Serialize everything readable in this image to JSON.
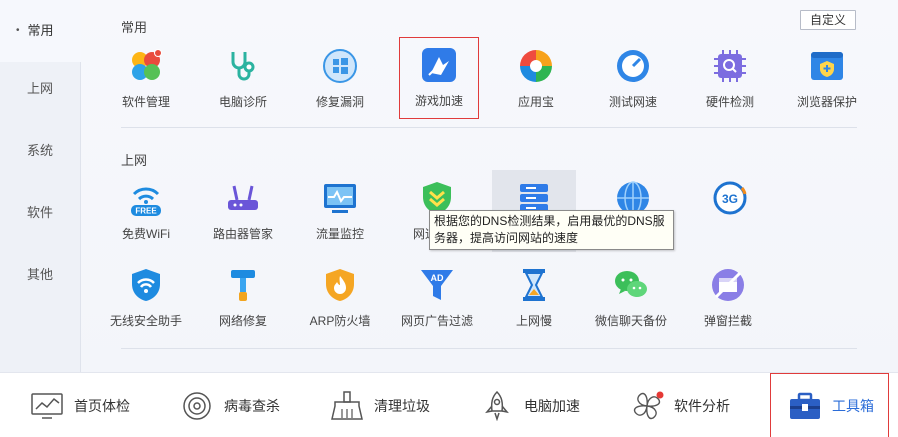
{
  "sidebar": {
    "items": [
      {
        "label": "常用",
        "active": true
      },
      {
        "label": "上网"
      },
      {
        "label": "系统"
      },
      {
        "label": "软件"
      },
      {
        "label": "其他"
      }
    ]
  },
  "header": {
    "custom_label": "自定义"
  },
  "sections": {
    "common": {
      "title": "常用",
      "tools": [
        {
          "label": "软件管理",
          "icon": "software-manager-icon"
        },
        {
          "label": "电脑诊所",
          "icon": "stethoscope-icon"
        },
        {
          "label": "修复漏洞",
          "icon": "windows-repair-icon"
        },
        {
          "label": "游戏加速",
          "icon": "game-boost-icon"
        },
        {
          "label": "应用宝",
          "icon": "app-store-icon"
        },
        {
          "label": "测试网速",
          "icon": "speed-test-icon"
        },
        {
          "label": "硬件检测",
          "icon": "chip-inspect-icon"
        },
        {
          "label": "浏览器保护",
          "icon": "browser-protect-icon"
        }
      ]
    },
    "internet": {
      "title": "上网",
      "tools_row1": [
        {
          "label": "免费WiFi",
          "icon": "free-wifi-icon",
          "badge": "FREE"
        },
        {
          "label": "路由器管家",
          "icon": "router-icon"
        },
        {
          "label": "流量监控",
          "icon": "traffic-monitor-icon"
        },
        {
          "label": "网速保护",
          "icon": "speed-shield-icon"
        },
        {
          "label": "",
          "icon": "dns-server-icon"
        },
        {
          "label": "",
          "icon": "globe-icon"
        },
        {
          "label": "",
          "icon": "3g-icon",
          "badge": "3G"
        }
      ],
      "tools_row2": [
        {
          "label": "无线安全助手",
          "icon": "wifi-shield-icon"
        },
        {
          "label": "网络修复",
          "icon": "network-repair-icon"
        },
        {
          "label": "ARP防火墙",
          "icon": "arp-firewall-icon"
        },
        {
          "label": "网页广告过滤",
          "icon": "ad-filter-icon",
          "badge": "AD"
        },
        {
          "label": "上网慢",
          "icon": "hourglass-icon"
        },
        {
          "label": "微信聊天备份",
          "icon": "wechat-backup-icon"
        },
        {
          "label": "弹窗拦截",
          "icon": "popup-block-icon"
        }
      ]
    }
  },
  "tooltip": {
    "text": "根据您的DNS检测结果，启用最优的DNS服务器，提高访问网站的速度"
  },
  "bottom_nav": {
    "items": [
      {
        "label": "首页体检",
        "icon": "monitor-chart-icon"
      },
      {
        "label": "病毒查杀",
        "icon": "virus-scan-icon"
      },
      {
        "label": "清理垃圾",
        "icon": "broom-icon"
      },
      {
        "label": "电脑加速",
        "icon": "rocket-icon"
      },
      {
        "label": "软件分析",
        "icon": "pinwheel-icon"
      },
      {
        "label": "工具箱",
        "icon": "toolbox-icon",
        "active": true
      }
    ]
  },
  "colors": {
    "accent": "#2b6cd8",
    "highlight_border": "#e03b3b"
  }
}
